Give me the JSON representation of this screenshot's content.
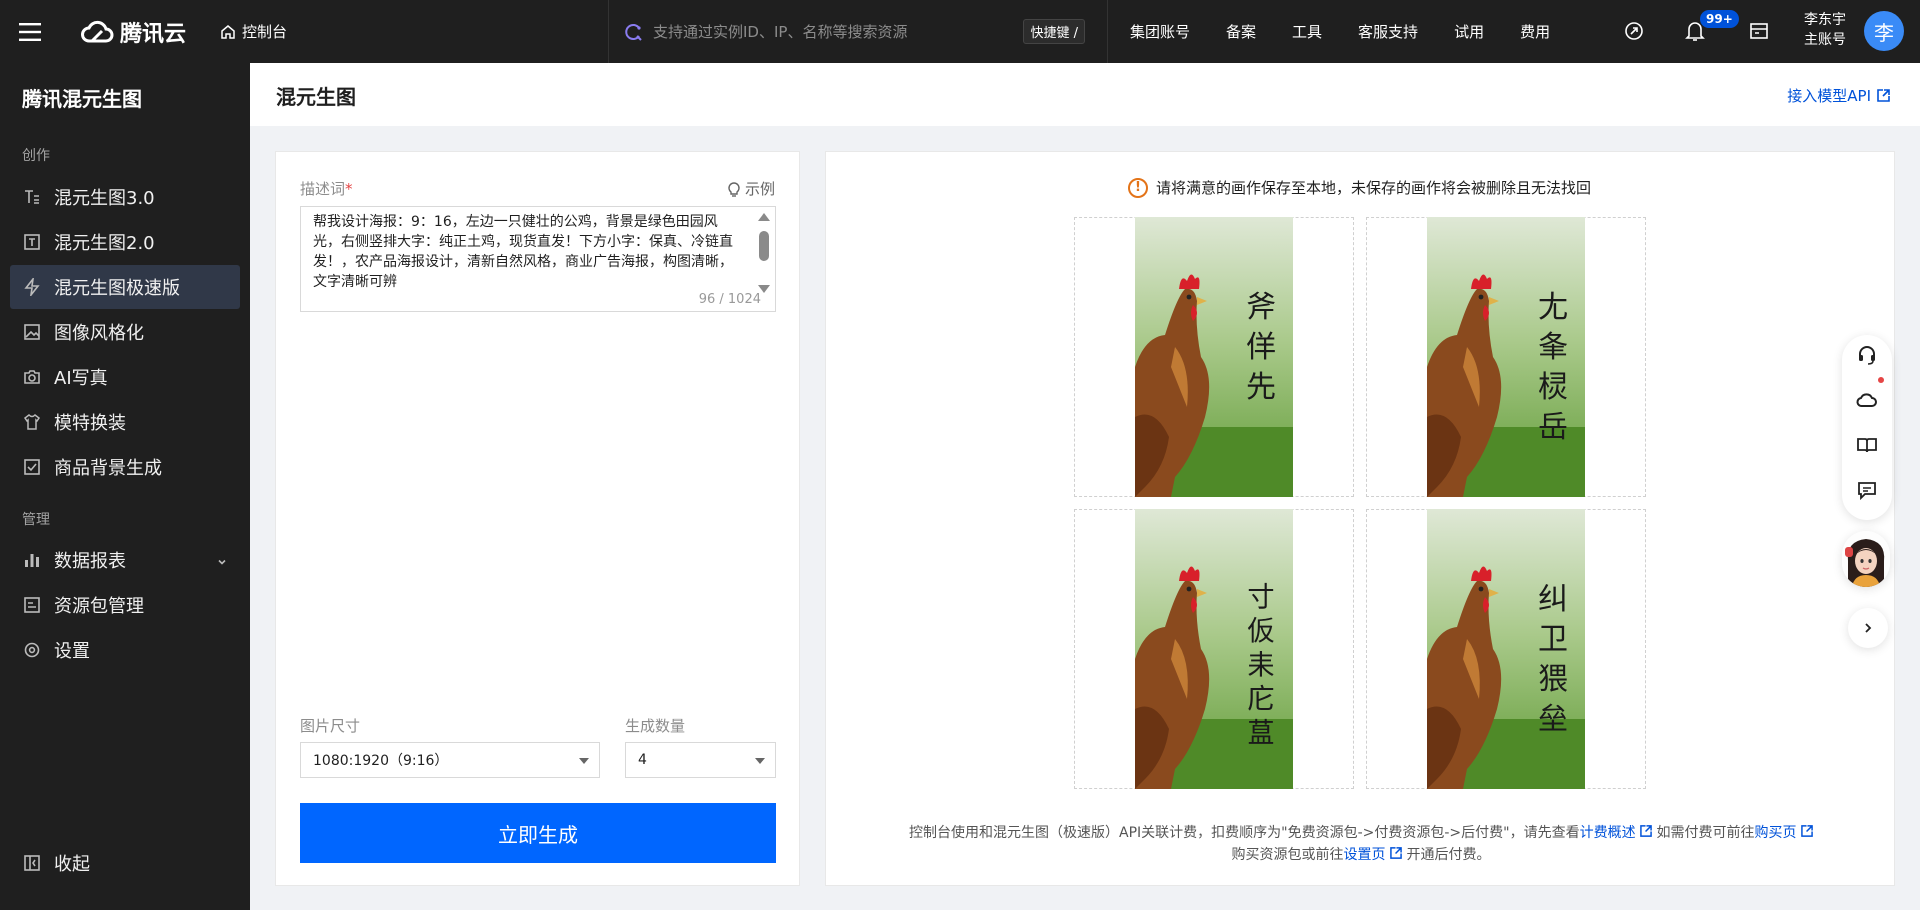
{
  "topbar": {
    "brand": "腾讯云",
    "console_label": "控制台",
    "search_placeholder": "支持通过实例ID、IP、名称等搜索资源",
    "shortcut": "快捷键 /",
    "nav": [
      "集团账号",
      "备案",
      "工具",
      "客服支持",
      "试用",
      "费用"
    ],
    "notification_badge": "99+",
    "user_name": "李东宇",
    "user_role": "主账号",
    "avatar_initial": "李"
  },
  "sidebar": {
    "title": "腾讯混元生图",
    "groups": {
      "create": "创作",
      "manage": "管理"
    },
    "create_items": [
      {
        "label": "混元生图3.0",
        "icon": "text-image-icon"
      },
      {
        "label": "混元生图2.0",
        "icon": "text-box-icon"
      },
      {
        "label": "混元生图极速版",
        "icon": "lightning-icon",
        "active": true
      },
      {
        "label": "图像风格化",
        "icon": "picture-icon"
      },
      {
        "label": "AI写真",
        "icon": "camera-icon"
      },
      {
        "label": "模特换装",
        "icon": "shirt-icon"
      },
      {
        "label": "商品背景生成",
        "icon": "product-bg-icon"
      }
    ],
    "manage_items": [
      {
        "label": "数据报表",
        "icon": "bar-chart-icon",
        "expandable": true
      },
      {
        "label": "资源包管理",
        "icon": "package-icon"
      },
      {
        "label": "设置",
        "icon": "settings-icon"
      }
    ],
    "collapse_label": "收起"
  },
  "page": {
    "title": "混元生图",
    "api_link": "接入模型API"
  },
  "form": {
    "prompt_label": "描述词",
    "required_mark": "*",
    "example_label": "示例",
    "prompt_value": "帮我设计海报：9：16，左边一只健壮的公鸡，背景是绿色田园风光，右侧竖排大字：纯正土鸡，现货直发！下方小字：保真、冷链直发！，农产品海报设计，清新自然风格，商业广告海报，构图清晰，文字清晰可辨",
    "prompt_count": "96 / 1024",
    "size_label": "图片尺寸",
    "size_value": "1080:1920（9:16）",
    "count_label": "生成数量",
    "count_value": "4",
    "generate_button": "立即生成"
  },
  "results": {
    "warning": "请将满意的画作保存至本地，未保存的画作将会被删除且无法找回",
    "images": [
      {
        "text": [
          "斧",
          "佯",
          "先"
        ]
      },
      {
        "text": [
          "尢",
          "夆",
          "棂",
          "岳"
        ]
      },
      {
        "text": [
          "寸",
          "仮",
          "耒",
          "庀",
          "蒀"
        ]
      },
      {
        "text": [
          "纠",
          "卫",
          "猥",
          "垒"
        ]
      }
    ],
    "footer_line1_prefix": "控制台使用和混元生图（极速版）API关联计费，扣费顺序为\"免费资源包->付费资源包->后付费\"，请先查看",
    "footer_link_billing": "计费概述",
    "footer_line1_mid": "如需付费可前往",
    "footer_link_buy": "购买页",
    "footer_line2_prefix": "购买资源包或前往",
    "footer_link_settings": "设置页",
    "footer_line2_suffix": "开通后付费。"
  },
  "floating_toolbar": {
    "icons": [
      "headset-icon",
      "cloud-icon",
      "book-icon",
      "feedback-icon"
    ]
  },
  "colors": {
    "topbar_bg": "#1f1f1f",
    "accent": "#0066ff",
    "link": "#0052d9",
    "warning": "#e37318"
  }
}
